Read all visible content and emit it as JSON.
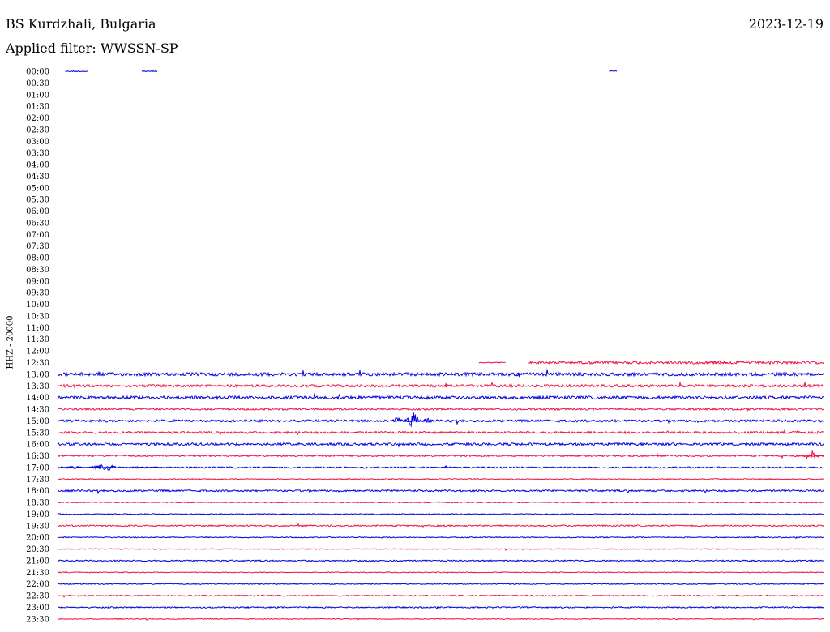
{
  "header": {
    "station": "BS Kurdzhali, Bulgaria",
    "date": "2023-12-19",
    "filter": "Applied filter: WWSSN-SP",
    "channel": "HHZ - 20000"
  },
  "colors": {
    "odd": "#0000dd",
    "even": "#ee1144"
  },
  "chart_data": {
    "type": "line",
    "title": "BS Kurdzhali, Bulgaria",
    "ylabel": "HHZ - 20000",
    "time_labels": [
      "00:00",
      "00:30",
      "01:00",
      "01:30",
      "02:00",
      "02:30",
      "03:00",
      "03:30",
      "04:00",
      "04:30",
      "05:00",
      "05:30",
      "06:00",
      "06:30",
      "07:00",
      "07:30",
      "08:00",
      "08:30",
      "09:00",
      "09:30",
      "10:00",
      "10:30",
      "11:00",
      "11:30",
      "12:00",
      "12:30",
      "13:00",
      "13:30",
      "14:00",
      "14:30",
      "15:00",
      "15:30",
      "16:00",
      "16:30",
      "17:00",
      "17:30",
      "18:00",
      "18:30",
      "19:00",
      "19:30",
      "20:00",
      "20:30",
      "21:00",
      "21:30",
      "22:00",
      "22:30",
      "23:00",
      "23:30"
    ],
    "x_unit": "fraction of 30-minute row",
    "segments": [
      {
        "row": 0,
        "start": 0.01,
        "end": 0.04,
        "noise": 0.6
      },
      {
        "row": 0,
        "start": 0.11,
        "end": 0.13,
        "noise": 0.6
      },
      {
        "row": 0,
        "start": 0.72,
        "end": 0.73,
        "noise": 0.6
      },
      {
        "row": 25,
        "start": 0.55,
        "end": 0.585,
        "noise": 0.6
      },
      {
        "row": 25,
        "start": 0.615,
        "end": 1.0,
        "noise": 1.6
      },
      {
        "row": 26,
        "start": 0.0,
        "end": 1.0,
        "noise": 2.0
      },
      {
        "row": 27,
        "start": 0.0,
        "end": 1.0,
        "noise": 1.6
      },
      {
        "row": 28,
        "start": 0.0,
        "end": 1.0,
        "noise": 1.8
      },
      {
        "row": 29,
        "start": 0.0,
        "end": 1.0,
        "noise": 1.1
      },
      {
        "row": 30,
        "start": 0.0,
        "end": 1.0,
        "noise": 1.4
      },
      {
        "row": 31,
        "start": 0.0,
        "end": 1.0,
        "noise": 1.3
      },
      {
        "row": 32,
        "start": 0.0,
        "end": 1.0,
        "noise": 1.5
      },
      {
        "row": 33,
        "start": 0.0,
        "end": 1.0,
        "noise": 1.0
      },
      {
        "row": 34,
        "start": 0.0,
        "end": 1.0,
        "noise": 0.9
      },
      {
        "row": 35,
        "start": 0.0,
        "end": 1.0,
        "noise": 0.6
      },
      {
        "row": 36,
        "start": 0.0,
        "end": 1.0,
        "noise": 1.1
      },
      {
        "row": 37,
        "start": 0.0,
        "end": 1.0,
        "noise": 0.6
      },
      {
        "row": 38,
        "start": 0.0,
        "end": 1.0,
        "noise": 0.6
      },
      {
        "row": 39,
        "start": 0.0,
        "end": 1.0,
        "noise": 0.9
      },
      {
        "row": 40,
        "start": 0.0,
        "end": 1.0,
        "noise": 0.6
      },
      {
        "row": 41,
        "start": 0.0,
        "end": 1.0,
        "noise": 0.5
      },
      {
        "row": 42,
        "start": 0.0,
        "end": 1.0,
        "noise": 0.8
      },
      {
        "row": 43,
        "start": 0.0,
        "end": 1.0,
        "noise": 0.5
      },
      {
        "row": 44,
        "start": 0.0,
        "end": 1.0,
        "noise": 0.6
      },
      {
        "row": 45,
        "start": 0.0,
        "end": 1.0,
        "noise": 0.7
      },
      {
        "row": 46,
        "start": 0.0,
        "end": 1.0,
        "noise": 0.8
      },
      {
        "row": 47,
        "start": 0.0,
        "end": 1.0,
        "noise": 0.5
      }
    ],
    "events": [
      {
        "row": 30,
        "start": 0.435,
        "end": 0.5,
        "amplitude": 11
      },
      {
        "row": 33,
        "start": 0.975,
        "end": 1.0,
        "amplitude": 10
      },
      {
        "row": 34,
        "start": 0.0,
        "end": 0.14,
        "amplitude": 4
      },
      {
        "row": 26,
        "start": 0.595,
        "end": 0.61,
        "amplitude": 4
      },
      {
        "row": 27,
        "start": 0.505,
        "end": 0.51,
        "amplitude": 4
      },
      {
        "row": 34,
        "start": 0.505,
        "end": 0.51,
        "amplitude": 4
      },
      {
        "row": 25,
        "start": 0.855,
        "end": 0.875,
        "amplitude": 3
      }
    ]
  }
}
